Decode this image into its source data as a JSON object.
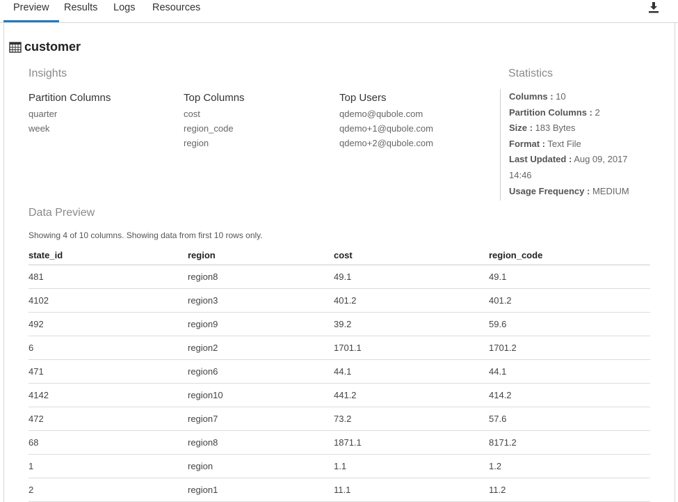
{
  "tabs": [
    {
      "label": "Preview",
      "active": true
    },
    {
      "label": "Results",
      "active": false
    },
    {
      "label": "Logs",
      "active": false
    },
    {
      "label": "Resources",
      "active": false
    }
  ],
  "toolbar": {
    "download_icon": "download-icon"
  },
  "table_name": "customer",
  "insights": {
    "heading": "Insights",
    "partition_columns": {
      "label": "Partition Columns",
      "items": [
        "quarter",
        "week"
      ]
    },
    "top_columns": {
      "label": "Top Columns",
      "items": [
        "cost",
        "region_code",
        "region"
      ]
    },
    "top_users": {
      "label": "Top Users",
      "items": [
        "qdemo@qubole.com",
        "qdemo+1@qubole.com",
        "qdemo+2@qubole.com"
      ]
    }
  },
  "statistics": {
    "heading": "Statistics",
    "columns": {
      "label": "Columns :",
      "value": " 10"
    },
    "partition_columns": {
      "label": "Partition Columns :",
      "value": " 2"
    },
    "size": {
      "label": "Size :",
      "value": " 183 Bytes"
    },
    "format": {
      "label": "Format :",
      "value": " Text File"
    },
    "last_updated": {
      "label": "Last Updated :",
      "value": " Aug 09, 2017 14:46"
    },
    "usage_frequency": {
      "label": "Usage Frequency :",
      "value": " MEDIUM"
    }
  },
  "data_preview": {
    "heading": "Data Preview",
    "showing_text": "Showing 4 of 10 columns. Showing data from first 10 rows only.",
    "columns": [
      "state_id",
      "region",
      "cost",
      "region_code"
    ],
    "rows": [
      [
        "481",
        "region8",
        "49.1",
        "49.1"
      ],
      [
        "4102",
        "region3",
        "401.2",
        "401.2"
      ],
      [
        "492",
        "region9",
        "39.2",
        "59.6"
      ],
      [
        "6",
        "region2",
        "1701.1",
        "1701.2"
      ],
      [
        "471",
        "region6",
        "44.1",
        "44.1"
      ],
      [
        "4142",
        "region10",
        "441.2",
        "414.2"
      ],
      [
        "472",
        "region7",
        "73.2",
        "57.6"
      ],
      [
        "68",
        "region8",
        "1871.1",
        "8171.2"
      ],
      [
        "1",
        "region",
        "1.1",
        "1.2"
      ],
      [
        "2",
        "region1",
        "11.1",
        "11.2"
      ]
    ]
  }
}
